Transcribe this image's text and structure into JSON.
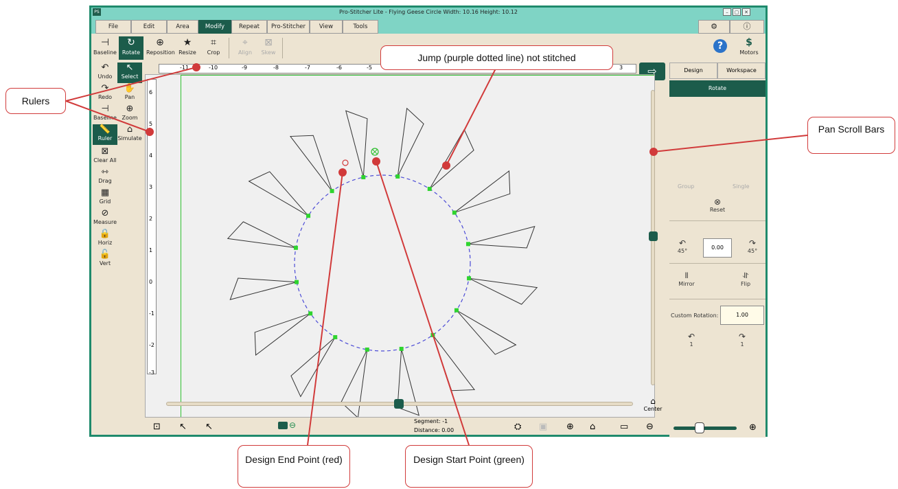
{
  "window": {
    "logo": "PS",
    "title": "Pro-Stitcher Lite  -  Flying Geese Circle  Width: 10.16  Height: 10.12",
    "minimize": "–",
    "maximize": "▢",
    "close": "✕"
  },
  "tabs": [
    {
      "label": "File"
    },
    {
      "label": "Edit"
    },
    {
      "label": "Area"
    },
    {
      "label": "Modify",
      "active": true
    },
    {
      "label": "Repeat"
    },
    {
      "label": "Pro-Stitcher"
    },
    {
      "label": "View"
    },
    {
      "label": "Tools"
    }
  ],
  "right_tabs": {
    "settings_icon": "gear-icon",
    "info_icon": "info-icon",
    "settings_glyph": "⚙",
    "info_glyph": "ⓘ"
  },
  "toolbar": {
    "items": [
      {
        "label": "Baseline",
        "icon": "baseline-icon",
        "glyph": "⊣"
      },
      {
        "label": "Rotate",
        "icon": "rotate-icon",
        "glyph": "↻",
        "selected": true
      },
      {
        "label": "Reposition",
        "icon": "reposition-icon",
        "glyph": "⊕"
      },
      {
        "label": "Resize",
        "icon": "resize-icon",
        "glyph": "★"
      },
      {
        "label": "Crop",
        "icon": "crop-icon",
        "glyph": "⌗"
      },
      {
        "label": "Align",
        "icon": "align-icon",
        "glyph": "⌖",
        "disabled": true
      },
      {
        "label": "Skew",
        "icon": "skew-icon",
        "glyph": "⊠",
        "disabled": true
      }
    ],
    "help_glyph": "?",
    "motors_label": "Motors",
    "motors_glyph": "$"
  },
  "left_tools": [
    {
      "label": "Undo",
      "glyph": "↶",
      "name": "undo"
    },
    {
      "label": "Select",
      "glyph": "↖",
      "name": "select",
      "selected": true
    },
    {
      "label": "Redo",
      "glyph": "↷",
      "name": "redo"
    },
    {
      "label": "Pan",
      "glyph": "✋",
      "name": "pan"
    },
    {
      "label": "Baseline",
      "glyph": "⊣",
      "name": "baseline"
    },
    {
      "label": "Zoom",
      "glyph": "⊕",
      "name": "zoom"
    },
    {
      "label": "Ruler",
      "glyph": "📏",
      "name": "ruler",
      "selected": true
    },
    {
      "label": "Simulate",
      "glyph": "⌂",
      "name": "simulate"
    },
    {
      "label": "Clear All",
      "glyph": "⊠",
      "name": "clear-all"
    },
    {
      "label": "Drag",
      "glyph": "⇿",
      "name": "drag"
    },
    {
      "label": "Grid",
      "glyph": "▦",
      "name": "grid"
    },
    {
      "label": "Measure",
      "glyph": "⊘",
      "name": "measure"
    },
    {
      "label": "Horiz",
      "glyph": "🔒",
      "name": "horiz"
    },
    {
      "label": "Vert",
      "glyph": "🔓",
      "name": "vert"
    }
  ],
  "ruler": {
    "h_ticks": [
      "-11",
      "-10",
      "-9",
      "-8",
      "-7",
      "-6",
      "-5",
      "3"
    ],
    "v_ticks": [
      "6",
      "5",
      "4",
      "3",
      "2",
      "1",
      "0",
      "-1",
      "-2",
      "-3"
    ]
  },
  "right_panel": {
    "tab_design": "Design",
    "tab_workspace": "Workspace",
    "header": "Rotate",
    "group": "Group",
    "single": "Single",
    "reset": "Reset",
    "ccw_label": "45°",
    "cw_label": "45°",
    "angle_value": "0.00",
    "mirror": "Mirror",
    "flip": "Flip",
    "custom_rotation_label": "Custom Rotation:",
    "custom_rotation_value": "1.00",
    "custom_ccw": "1",
    "custom_cw": "1"
  },
  "status": {
    "segment": "Segment: -1",
    "distance": "Distance: 0.00",
    "center": "Center"
  },
  "callouts": {
    "rulers": "Rulers",
    "jump": "Jump (purple dotted line) not stitched",
    "pan": "Pan Scroll Bars",
    "end_point": "Design End Point (red)",
    "start_point": "Design Start Point (green)"
  },
  "colors": {
    "accent": "#1c5c4b",
    "titlebar": "#7fd4c5",
    "callout_red": "#d13a3a",
    "jump_line": "#4b4bd6",
    "node_green": "#2fd42f"
  }
}
